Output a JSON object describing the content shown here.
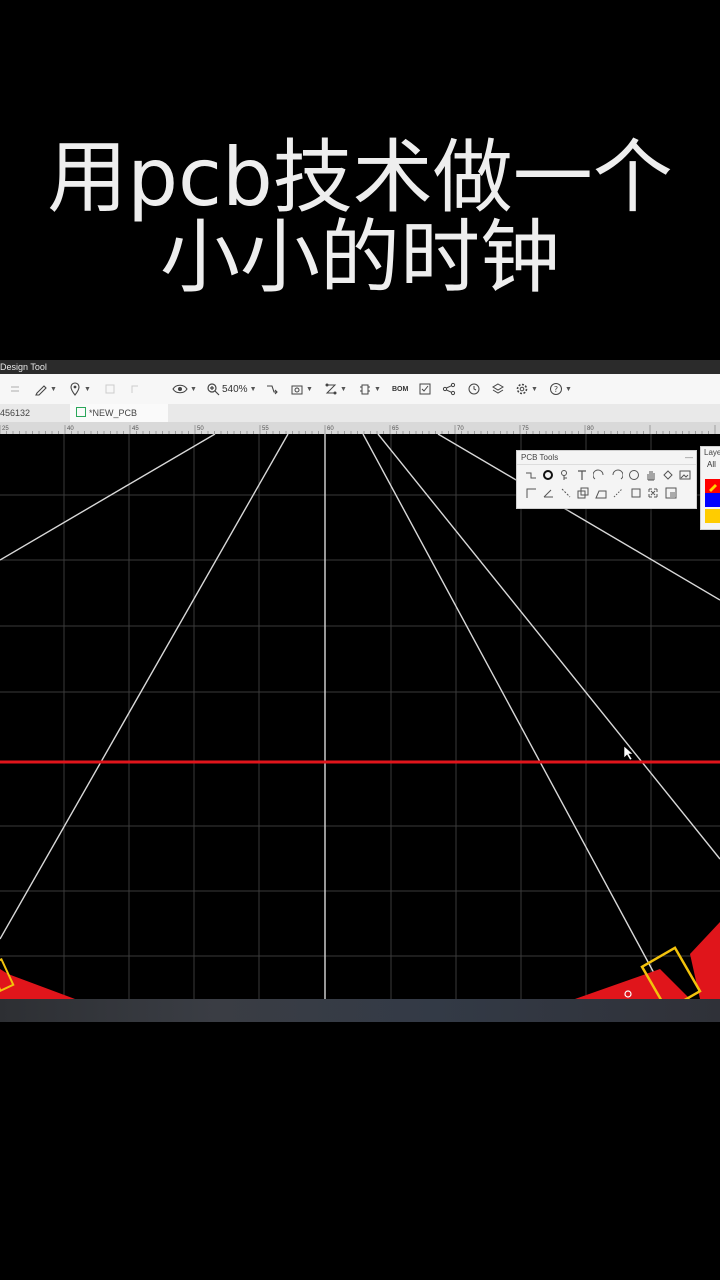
{
  "caption": {
    "line1": "用pcb技术做一个",
    "line2": "小小的时钟"
  },
  "app": {
    "title": "Design Tool",
    "toolbar": {
      "zoom": "540%",
      "bom_label": "BOM"
    },
    "tabs": [
      {
        "label": "456132"
      },
      {
        "label": "*NEW_PCB"
      }
    ],
    "ruler_labels": [
      "25",
      "40",
      "45",
      "50",
      "55",
      "60",
      "65",
      "70",
      "75",
      "80"
    ]
  },
  "pcb_tools": {
    "title": "PCB Tools",
    "row1_icons": [
      "track-icon",
      "via-icon",
      "pad-icon",
      "text-icon",
      "arc-icon",
      "arc2-icon",
      "circle-icon",
      "pan-icon",
      "region-icon",
      "image-icon"
    ],
    "row2_icons": [
      "corner-icon",
      "angle-icon",
      "dim-icon",
      "copy-icon",
      "solid-icon",
      "dash-icon",
      "rect-icon",
      "select-icon",
      "canvas-icon"
    ]
  },
  "layers": {
    "title": "Layer",
    "all_label": "All",
    "colors": [
      "#ff0000",
      "#0000ff",
      "#ffcc00"
    ]
  },
  "colors": {
    "top_copper": "#ff0000",
    "silkscreen": "#ffcc00",
    "grid": "#3a3a3a"
  }
}
